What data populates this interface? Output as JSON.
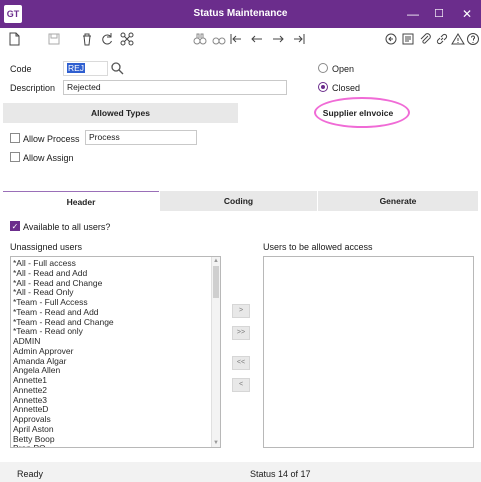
{
  "window": {
    "logo": "GT",
    "title": "Status Maintenance",
    "controls": [
      "—",
      "☐",
      "✕"
    ]
  },
  "toolbar": {
    "icons": [
      "new-document-icon",
      "save-icon",
      "delete-icon",
      "refresh-icon",
      "network-icon",
      "binoculars-icon",
      "find-icon",
      "first-record-icon",
      "previous-icon",
      "next-icon",
      "last-record-icon",
      "history-icon",
      "notes-icon",
      "attachment-icon",
      "link-icon",
      "alert-icon",
      "help-icon"
    ]
  },
  "form": {
    "code_label": "Code",
    "code_value": "REJ",
    "description_label": "Description",
    "description_value": "Rejected",
    "status_options": [
      {
        "label": "Open",
        "checked": false
      },
      {
        "label": "Closed",
        "checked": true
      }
    ]
  },
  "upper_tabs": [
    {
      "label": "Allowed Types",
      "active": false
    },
    {
      "label": "Supplier eInvoice",
      "active": true
    }
  ],
  "supplier_einvoice": {
    "allow_process_label": "Allow Process",
    "allow_process_checked": false,
    "process_value": "Process",
    "allow_assign_label": "Allow Assign",
    "allow_assign_checked": false
  },
  "lower_tabs": [
    {
      "label": "Header",
      "active": true
    },
    {
      "label": "Coding",
      "active": false
    },
    {
      "label": "Generate",
      "active": false
    }
  ],
  "header": {
    "available_label": "Available to all users?",
    "available_checked": true,
    "unassigned_label": "Unassigned users",
    "allowed_label": "Users to be allowed access",
    "unassigned_users": [
      "*All - Full access",
      "*All - Read and Add",
      "*All - Read and Change",
      "*All - Read Only",
      "*Team - Full Access",
      "*Team - Read and Add",
      "*Team - Read and Change",
      "*Team - Read only",
      "ADMIN",
      "Admin Approver",
      "Amanda Algar",
      "Angela Allen",
      "Annette1",
      "Annette2",
      "Annette3",
      "AnnetteD",
      "Approvals",
      "April Aston",
      "Betty Boop",
      "Bron PO"
    ],
    "allowed_users": [],
    "move_buttons": [
      ">",
      ">>",
      "<<",
      "<"
    ]
  },
  "statusbar": {
    "left": "Ready",
    "center": "Status 14 of 17"
  },
  "colors": {
    "brand": "#6b2d8c",
    "annotation": "#f06bd6"
  }
}
